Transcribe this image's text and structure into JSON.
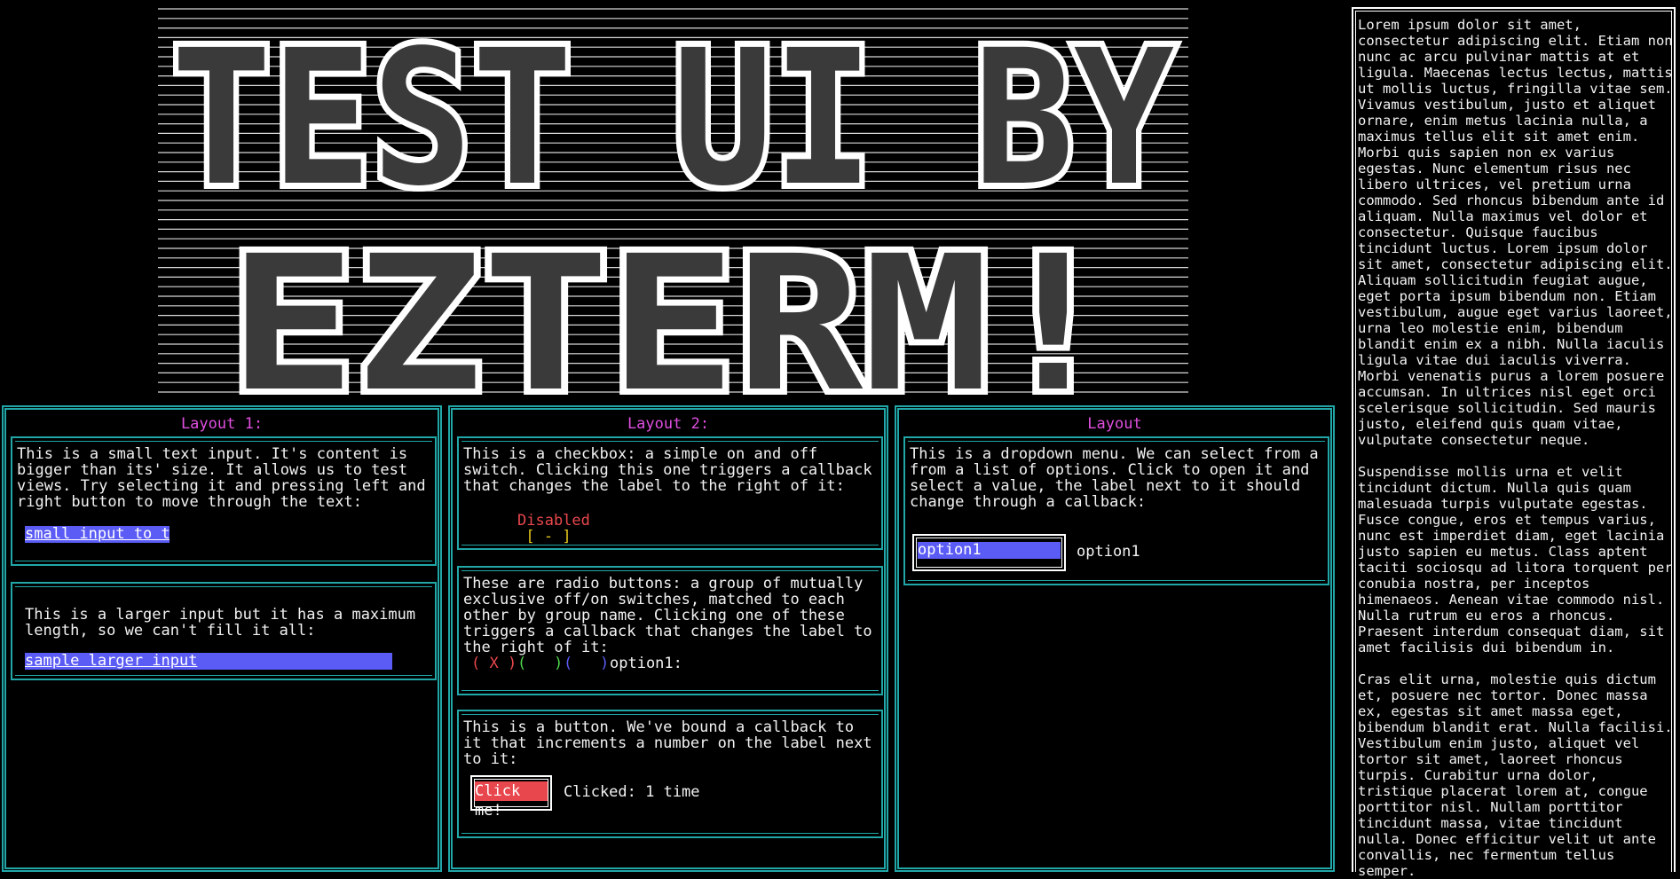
{
  "banner": {
    "lines": [
      "TEST UI BY",
      "EZTERM!"
    ]
  },
  "colors": {
    "border": "#21a7a7",
    "title": "#e04fe0",
    "input_bg": "#5b5bf5",
    "danger": "#e8474d",
    "checkbox_bracket": "#e8c81f",
    "radio1": "#e8474d",
    "radio2": "#4dd44d",
    "radio3": "#5b5bf5"
  },
  "layout1": {
    "title": "Layout 1:",
    "small_input_desc": "This is a small text input. It's content is bigger than its' size. It allows us to test views. Try selecting it and pressing left and right button to move through the text:",
    "small_input_value": "small input to tes",
    "large_input_desc": "This is a larger input but it has a maximum length, so we can't fill it all:",
    "large_input_value": "sample larger input"
  },
  "layout2": {
    "title": "Layout 2:",
    "checkbox_desc": "This is a checkbox: a simple on and off switch. Clicking this one triggers a callback that changes the label to the right of it:",
    "checkbox_open": "[",
    "checkbox_mark": "-",
    "checkbox_close": "]",
    "checkbox_label": "Disabled",
    "radio_desc": "These are radio buttons: a group of mutually exclusive off/on switches, matched to each other by group name. Clicking one of these triggers a callback that changes the label to the right of it:",
    "radios": [
      {
        "open": "(",
        "mark": "X",
        "close": ")"
      },
      {
        "open": "(",
        "mark": " ",
        "close": ")"
      },
      {
        "open": "(",
        "mark": " ",
        "close": ")"
      }
    ],
    "radio_label": "option1:",
    "button_desc": "This is a button. We've bound a callback to it that increments a number on the label next to it:",
    "button_label": "Click me!",
    "clicked_label": "Clicked: 1 time"
  },
  "layout3": {
    "title": "Layout",
    "dropdown_desc": "This is a dropdown menu. We can select from a from a list of options. Click to open it and select a value, the label next to it should change through a callback:",
    "dropdown_value": "option1",
    "dropdown_label": "option1"
  },
  "sidebar": {
    "text": "Lorem ipsum dolor sit amet, consectetur adipiscing elit. Etiam non nunc ac arcu pulvinar mattis at et ligula. Maecenas lectus lectus, mattis ut mollis luctus, fringilla vitae sem. Vivamus vestibulum, justo et aliquet ornare, enim metus lacinia nulla, a maximus tellus elit sit amet enim. Morbi quis sapien non ex varius egestas. Nunc elementum risus nec libero ultrices, vel pretium urna commodo. Sed rhoncus bibendum ante id aliquam. Nulla maximus vel dolor et consectetur. Quisque faucibus tincidunt luctus. Lorem ipsum dolor sit amet, consectetur adipiscing elit. Aliquam sollicitudin feugiat augue, eget porta ipsum bibendum non. Etiam vestibulum, augue eget varius laoreet, urna leo molestie enim, bibendum blandit enim ex a nibh. Nulla iaculis ligula vitae dui iaculis viverra. Morbi venenatis purus a lorem posuere accumsan. In ultrices nisl eget orci scelerisque sollicitudin. Sed mauris justo, eleifend quis quam vitae, vulputate consectetur neque.\n\nSuspendisse mollis urna et velit tincidunt dictum. Nulla quis quam malesuada turpis vulputate egestas. Fusce congue, eros et tempus varius, nunc est imperdiet diam, eget lacinia justo sapien eu metus. Class aptent taciti sociosqu ad litora torquent per conubia nostra, per inceptos himenaeos. Aenean vitae commodo nisl. Nulla rutrum eu eros a rhoncus. Praesent interdum consequat diam, sit amet facilisis dui bibendum in.\n\nCras elit urna, molestie quis dictum et, posuere nec tortor. Donec massa ex, egestas sit amet massa eget, bibendum blandit erat. Nulla facilisi. Vestibulum enim justo, aliquet vel tortor sit amet, laoreet rhoncus turpis. Curabitur urna dolor, tristique placerat lorem at, congue porttitor nisl. Nullam porttitor tincidunt massa, vitae tincidunt nulla. Donec efficitur velit ut ante convallis, nec fermentum tellus semper."
  }
}
